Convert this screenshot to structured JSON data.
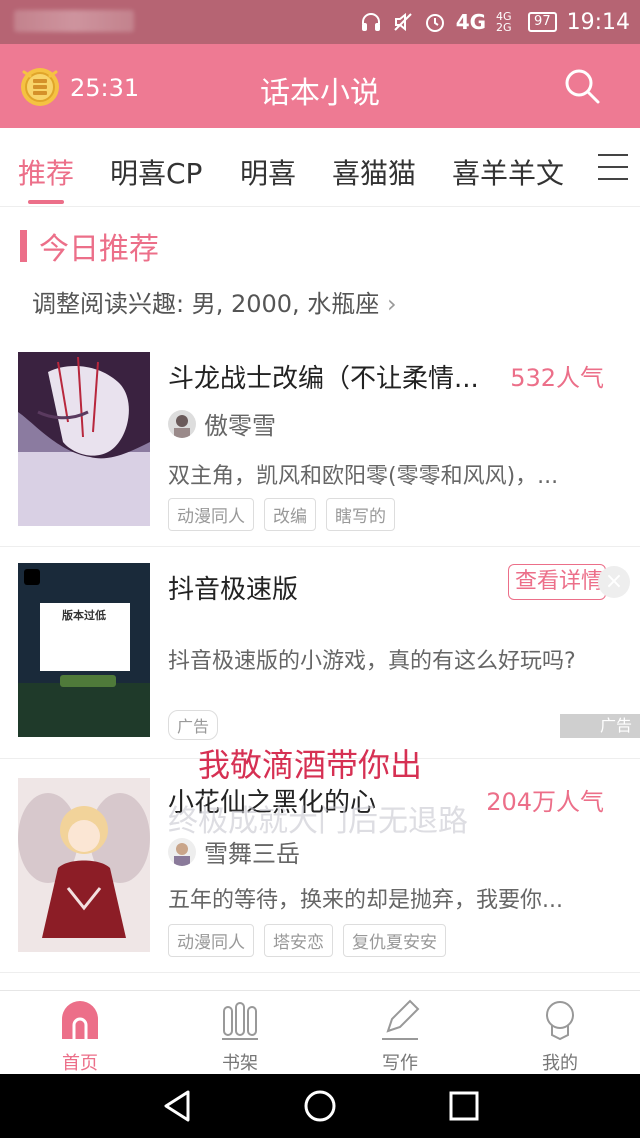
{
  "status_bar": {
    "network": "4G",
    "signal_small": "4G 2G",
    "battery": "97",
    "time": "19:14"
  },
  "header": {
    "timer": "25:31",
    "title": "话本小说"
  },
  "tabs": [
    {
      "label": "推荐",
      "active": true
    },
    {
      "label": "明喜CP"
    },
    {
      "label": "明喜"
    },
    {
      "label": "喜猫猫"
    },
    {
      "label": "喜羊羊文"
    }
  ],
  "section": {
    "title": "今日推荐",
    "preference": "调整阅读兴趣: 男, 2000, 水瓶座"
  },
  "stories": [
    {
      "title": "斗龙战士改编（不让柔情...",
      "popularity": "532人气",
      "author": "傲零雪",
      "description": "双主角，凯风和欧阳零(零零和风风)，...",
      "tags": [
        "动漫同人",
        "改编",
        "瞎写的"
      ]
    },
    {
      "title": "小花仙之黑化的心",
      "popularity": "204万人气",
      "author": "雪舞三岳",
      "description": "五年的等待，换来的却是抛弃，我要你...",
      "tags": [
        "动漫同人",
        "塔安恋",
        "复仇夏安安"
      ]
    }
  ],
  "ad": {
    "title": "抖音极速版",
    "description": "抖音极速版的小游戏，真的有这么好玩吗?",
    "button": "查看详情",
    "close": "×",
    "tag": "广告",
    "mark": "广告",
    "cover_heading": "版本过低"
  },
  "overlay": {
    "line1": "我敬滴酒带你出",
    "line2": "终极成就大门后无退路"
  },
  "bottom_nav": [
    {
      "label": "首页",
      "active": true
    },
    {
      "label": "书架"
    },
    {
      "label": "写作"
    },
    {
      "label": "我的"
    }
  ],
  "colors": {
    "accent": "#ec6f89",
    "header": "#ee7a93",
    "status_bar": "#b66473"
  }
}
